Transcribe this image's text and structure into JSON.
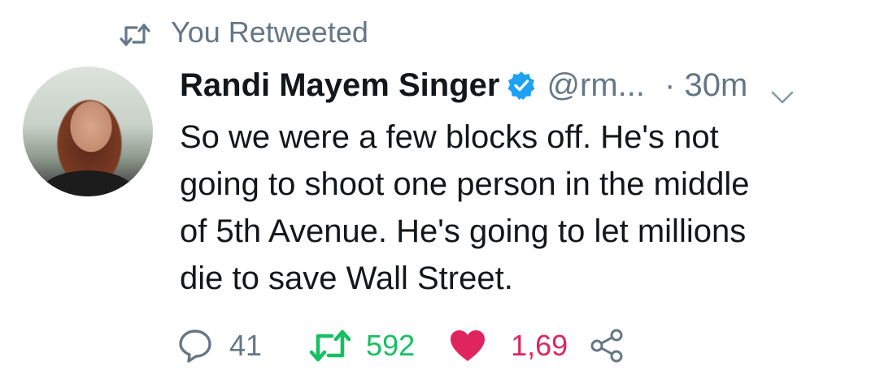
{
  "retweet_header": {
    "label": "You Retweeted",
    "icon": "retweet-icon"
  },
  "author": {
    "name": "Randi Mayem Singer",
    "handle": "@rm...",
    "verified": true,
    "time": "· 30m"
  },
  "tweet": {
    "lines": [
      "So we were a few blocks off. He's not",
      "going to shoot one person in the middle",
      "of 5th Avenue. He's going to let millions",
      "die to save Wall Street."
    ]
  },
  "actions": {
    "reply": {
      "icon": "reply-icon",
      "count": "41"
    },
    "retweet": {
      "icon": "retweet-icon",
      "count": "592",
      "color": "#17bf63"
    },
    "like": {
      "icon": "heart-icon",
      "count": "1,69",
      "color": "#e0245e"
    },
    "share": {
      "icon": "share-icon"
    }
  },
  "colors": {
    "secondary_text": "#657786",
    "verified_blue": "#1da1f2",
    "text": "#14171a"
  }
}
